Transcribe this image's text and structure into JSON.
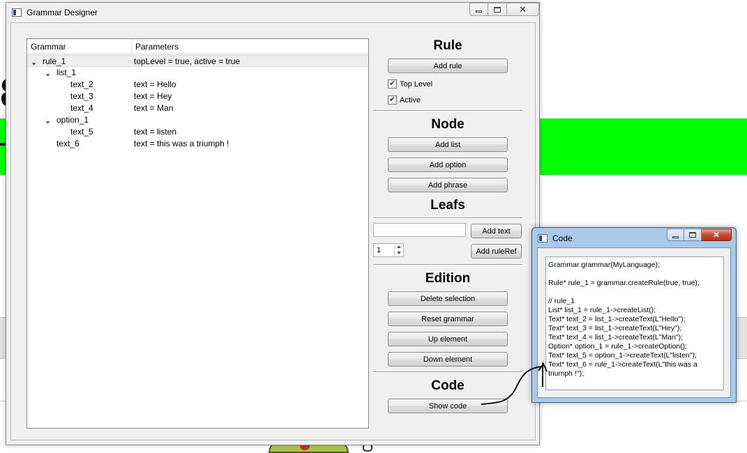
{
  "main_window": {
    "title": "Grammar Designer",
    "caption_buttons": {
      "minimize_icon": "minimize-icon",
      "maximize_icon": "maximize-icon",
      "close_glyph": "✕"
    }
  },
  "tree": {
    "columns": [
      "Grammar",
      "Parameters"
    ],
    "rows": [
      {
        "name": "rule_1",
        "param": "topLevel = true, active = true",
        "depth": 0,
        "expanded": true,
        "selected": true
      },
      {
        "name": "list_1",
        "param": "",
        "depth": 1,
        "expanded": true,
        "selected": false
      },
      {
        "name": "text_2",
        "param": "text = Hello",
        "depth": 2,
        "selected": false
      },
      {
        "name": "text_3",
        "param": "text = Hey",
        "depth": 2,
        "selected": false
      },
      {
        "name": "text_4",
        "param": "text = Man",
        "depth": 2,
        "selected": false
      },
      {
        "name": "option_1",
        "param": "",
        "depth": 1,
        "expanded": true,
        "selected": false
      },
      {
        "name": "text_5",
        "param": "text = listen",
        "depth": 2,
        "selected": false
      },
      {
        "name": "text_6",
        "param": "text = this was a triumph !",
        "depth": 1,
        "selected": false
      }
    ]
  },
  "panel": {
    "rule": {
      "title": "Rule",
      "add_rule": "Add rule",
      "top_level": {
        "label": "Top Level",
        "checked": true
      },
      "active": {
        "label": "Active",
        "checked": true
      }
    },
    "node": {
      "title": "Node",
      "add_list": "Add list",
      "add_option": "Add option",
      "add_phrase": "Add phrase"
    },
    "leafs": {
      "title": "Leafs",
      "text_value": "",
      "add_text": "Add text",
      "spin_value": "1",
      "add_ruleref": "Add ruleRef"
    },
    "edition": {
      "title": "Edition",
      "delete_selection": "Delete selection",
      "reset_grammar": "Reset grammar",
      "up_element": "Up element",
      "down_element": "Down element"
    },
    "code": {
      "title": "Code",
      "show_code": "Show code"
    }
  },
  "code_window": {
    "title": "Code",
    "content": "Grammar grammar(MyLanguage);\n\nRule* rule_1 = grammar.createRule(true, true);\n\n// rule_1\nList* list_1 = rule_1->createList();\nText* text_2 = list_1->createText(L\"Hello\");\nText* text_3 = list_1->createText(L\"Hey\");\nText* text_4 = list_1->createText(L\"Man\");\nOption* option_1 = rule_1->createOption();\nText* text_5 = option_1->createText(L\"listen\");\nText* text_6 = rule_1->createText(L\"this was a triumph !\");"
  },
  "colors": {
    "background_accent": "#00ff00",
    "window_bg": "#f0f0f0",
    "aero_frame": "#a8c9e8",
    "close_button": "#c8442b"
  }
}
